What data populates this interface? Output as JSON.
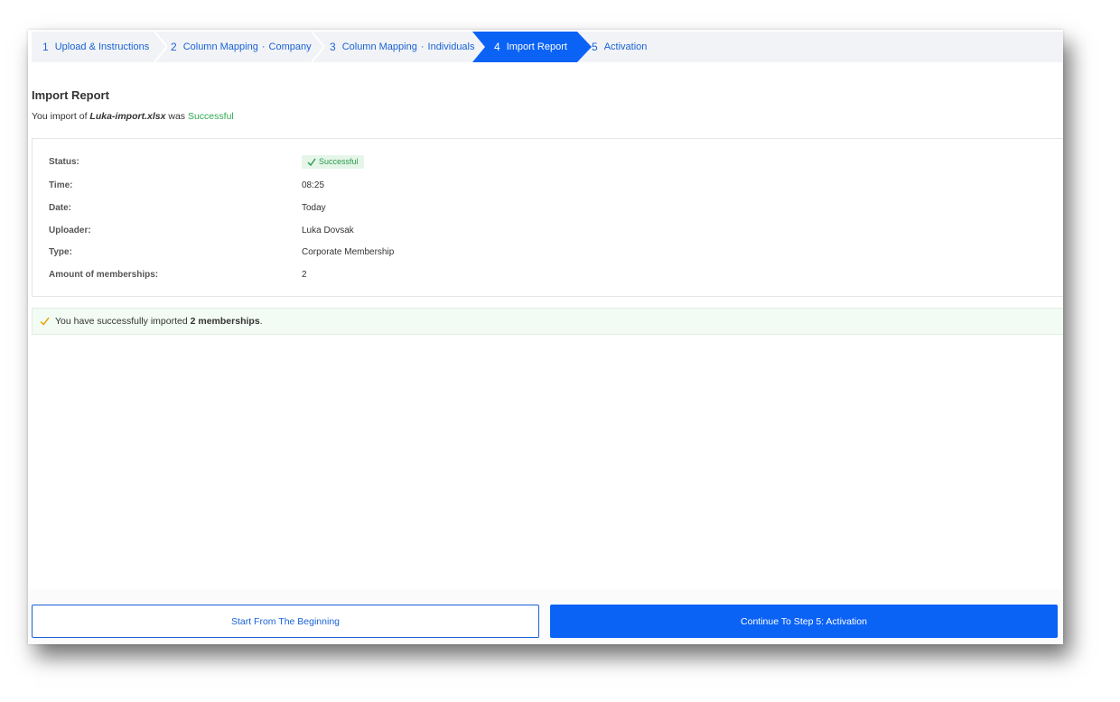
{
  "stepper": {
    "steps": [
      {
        "num": "1",
        "label": "Upload & Instructions"
      },
      {
        "num": "2",
        "label_a": "Column Mapping",
        "sep": "·",
        "label_b": "Company"
      },
      {
        "num": "3",
        "label_a": "Column Mapping",
        "sep": "·",
        "label_b": "Individuals"
      },
      {
        "num": "4",
        "label": "Import Report"
      },
      {
        "num": "5",
        "label": "Activation"
      }
    ],
    "active_color": "#0b63f6"
  },
  "report": {
    "title": "Import Report",
    "subtitle_prefix": "You import of",
    "file_name": "Luka-import.xlsx",
    "subtitle_mid": "was",
    "subtitle_status": "Successful"
  },
  "details": {
    "status_label": "Status:",
    "status_value": "Successful",
    "time_label": "Time:",
    "time_value": "08:25",
    "date_label": "Date:",
    "date_value": "Today",
    "uploader_label": "Uploader:",
    "uploader_value": "Luka Dovsak",
    "type_label": "Type:",
    "type_value": "Corporate Membership",
    "amount_label": "Amount of memberships:",
    "amount_value": "2"
  },
  "alert": {
    "prefix": "You have successfully imported",
    "count": "2 memberships",
    "suffix": "."
  },
  "footer": {
    "restart_label": "Start From The Beginning",
    "continue_label": "Continue To Step 5: Activation"
  }
}
